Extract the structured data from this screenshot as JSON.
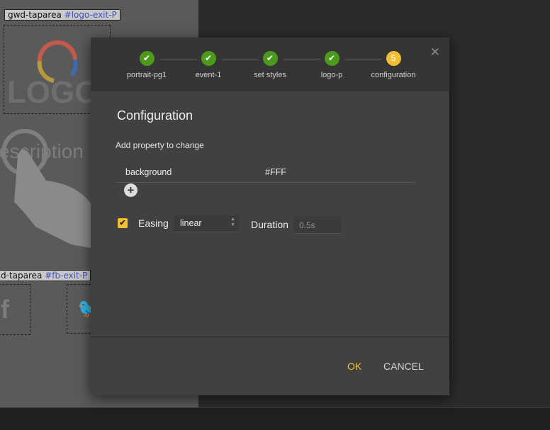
{
  "stage": {
    "top_area": {
      "label": "gwd-taparea",
      "id": "#logo-exit-P"
    },
    "logo_text": "LOGO",
    "description_text": "escription",
    "bottom_area": {
      "label": "d-taparea",
      "id": "#fb-exit-P"
    }
  },
  "dialog": {
    "steps": [
      {
        "label": "portrait-pg1",
        "status": "done"
      },
      {
        "label": "event-1",
        "status": "done"
      },
      {
        "label": "set styles",
        "status": "done"
      },
      {
        "label": "logo-p",
        "status": "done"
      },
      {
        "label": "configuration",
        "status": "active",
        "number": "5"
      }
    ],
    "close_icon": "close-icon",
    "title": "Configuration",
    "add_property_label": "Add property to change",
    "properties": [
      {
        "name": "background",
        "value": "#FFF"
      }
    ],
    "add_icon": "plus-icon",
    "easing": {
      "checked": true,
      "label": "Easing",
      "value": "linear"
    },
    "duration": {
      "label": "Duration",
      "placeholder": "0.5s"
    },
    "ok_label": "OK",
    "cancel_label": "CANCEL"
  },
  "colors": {
    "accent": "#f2be33",
    "step_done": "#4c9a1c",
    "dialog_bg": "#414141",
    "stepper_bg": "#353535"
  }
}
